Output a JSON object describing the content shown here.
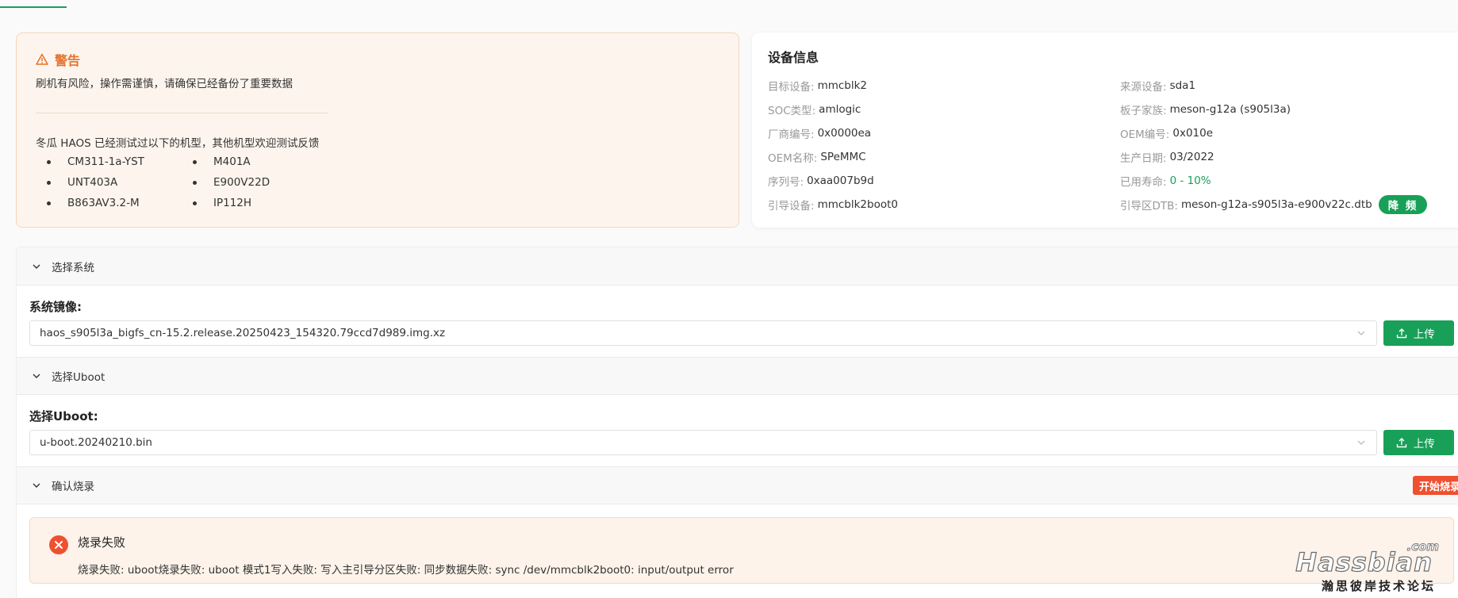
{
  "warning": {
    "title": "警告",
    "message": "刷机有风险，操作需谨慎，请确保已经备份了重要数据",
    "tested_title": "冬瓜 HAOS 已经测试过以下的机型，其他机型欢迎测试反馈",
    "models": [
      "CM311-1a-YST",
      "M401A",
      "UNT403A",
      "E900V22D",
      "B863AV3.2-M",
      "IP112H"
    ]
  },
  "device": {
    "title": "设备信息",
    "fields": [
      {
        "label": "目标设备:",
        "value": "mmcblk2"
      },
      {
        "label": "来源设备:",
        "value": "sda1"
      },
      {
        "label": "SOC类型:",
        "value": "amlogic"
      },
      {
        "label": "板子家族:",
        "value": "meson-g12a (s905l3a)"
      },
      {
        "label": "厂商编号:",
        "value": "0x0000ea"
      },
      {
        "label": "OEM编号:",
        "value": "0x010e"
      },
      {
        "label": "OEM名称:",
        "value": "SPeMMC"
      },
      {
        "label": "生产日期:",
        "value": "03/2022"
      },
      {
        "label": "序列号:",
        "value": "0xaa007b9d"
      },
      {
        "label": "已用寿命:",
        "value": "0 - 10%"
      },
      {
        "label": "引导设备:",
        "value": "mmcblk2boot0"
      },
      {
        "label": "引导区DTB:",
        "value": "meson-g12a-s905l3a-e900v22c.dtb"
      }
    ],
    "downclock_label": "降 频"
  },
  "sections": {
    "system": {
      "header": "选择系统",
      "field_label": "系统镜像:",
      "selected": "haos_s905l3a_bigfs_cn-15.2.release.20250423_154320.79ccd7d989.img.xz",
      "upload_label": "上传"
    },
    "uboot": {
      "header": "选择Uboot",
      "field_label": "选择Uboot:",
      "selected": "u-boot.20240210.bin",
      "upload_label": "上传"
    },
    "confirm": {
      "header": "确认烧录",
      "start_label": "开始烧录"
    }
  },
  "error": {
    "title": "烧录失败",
    "message": "烧录失败: uboot烧录失败: uboot 模式1写入失败: 写入主引导分区失败: 同步数据失败: sync /dev/mmcblk2boot0: input/output error"
  },
  "watermark": {
    "com": ".com",
    "brand": "Hassbian",
    "cn": "瀚思彼岸技术论坛"
  },
  "colors": {
    "accent": "#18a058",
    "warning": "#e4722c",
    "danger": "#ef5030"
  }
}
